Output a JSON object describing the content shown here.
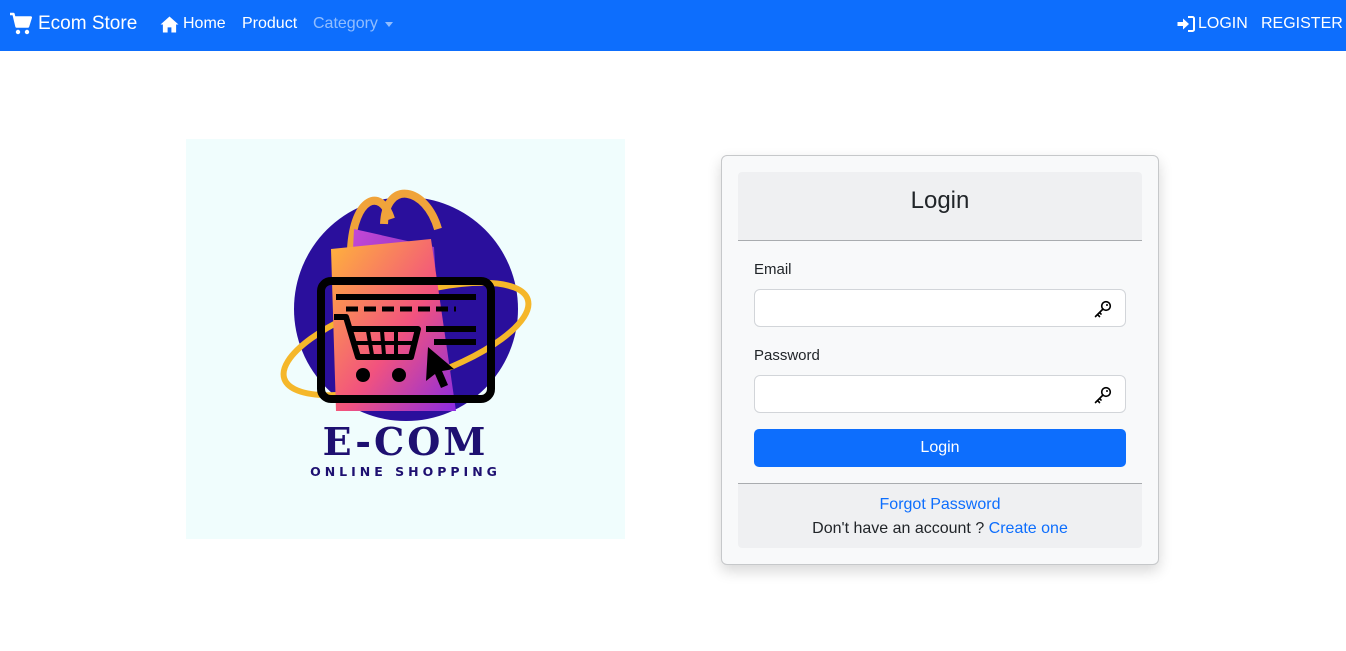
{
  "navbar": {
    "brand": "Ecom Store",
    "links": {
      "home": "Home",
      "product": "Product",
      "category": "Category",
      "login": "LOGIN",
      "register": "REGISTER"
    },
    "color": "#0d6efd"
  },
  "logo": {
    "title": "E-COM",
    "subtitle": "ONLINE SHOPPING"
  },
  "login_card": {
    "title": "Login",
    "email_label": "Email",
    "email_value": "",
    "password_label": "Password",
    "password_value": "",
    "submit_label": "Login",
    "forgot_password": "Forgot Password",
    "no_account_text": "Don't have an account ? ",
    "create_account": "Create one"
  },
  "icons": [
    "cart-icon",
    "home-icon",
    "caret-down-icon",
    "login-icon",
    "key-icon"
  ]
}
